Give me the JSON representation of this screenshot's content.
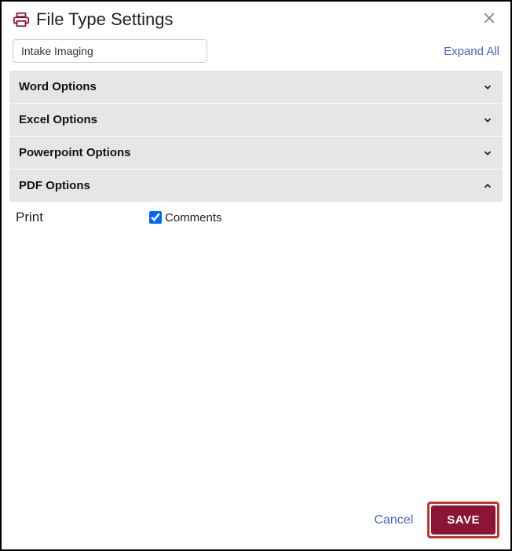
{
  "header": {
    "title": "File Type Settings"
  },
  "toolbar": {
    "search_value": "Intake Imaging",
    "expand_all": "Expand All"
  },
  "accordion": {
    "items": [
      {
        "label": "Word Options",
        "expanded": false
      },
      {
        "label": "Excel Options",
        "expanded": false
      },
      {
        "label": "Powerpoint Options",
        "expanded": false
      },
      {
        "label": "PDF Options",
        "expanded": true
      }
    ]
  },
  "pdf_body": {
    "row_label": "Print",
    "checkbox_label": "Comments",
    "checkbox_checked": true
  },
  "footer": {
    "cancel": "Cancel",
    "save": "SAVE"
  }
}
